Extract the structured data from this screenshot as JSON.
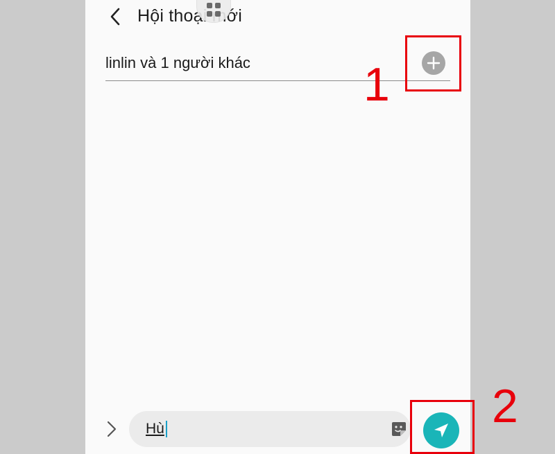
{
  "header": {
    "title": "Hội thoại mới",
    "back_icon": "chevron-left-icon",
    "floating_icon": "grid-icon"
  },
  "recipients": {
    "text": "linlin và 1 người khác",
    "add_icon": "plus-circle-icon"
  },
  "composer": {
    "expand_icon": "chevron-right-icon",
    "input_value": "Hù",
    "sticker_icon": "sticker-icon",
    "send_icon": "send-icon"
  },
  "callouts": [
    {
      "label": "1"
    },
    {
      "label": "2"
    }
  ],
  "colors": {
    "accent": "#1ab5b8",
    "callout": "#e8000b",
    "background": "#fafafa",
    "outer": "#cbcbcb"
  }
}
